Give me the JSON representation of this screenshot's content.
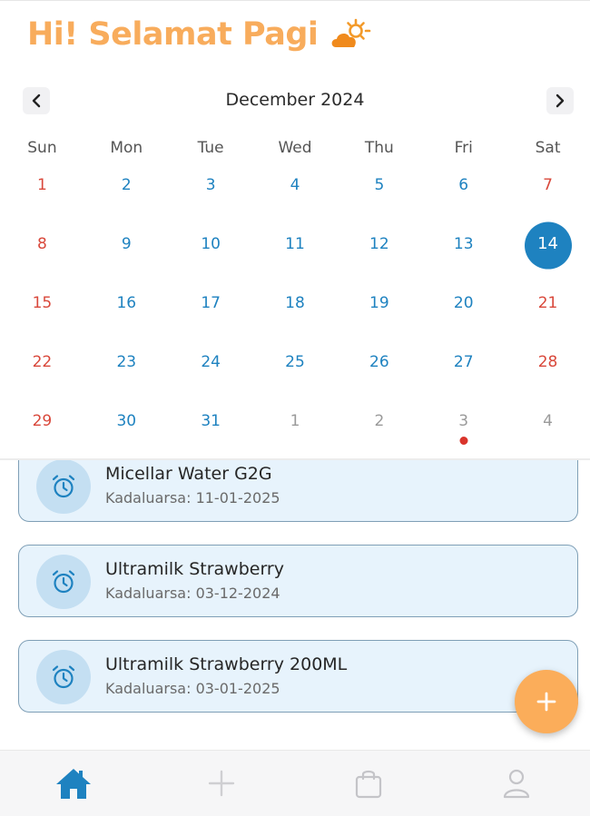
{
  "header": {
    "greeting": "Hi! Selamat Pagi",
    "weather_icon": "partly-sunny-icon"
  },
  "calendar": {
    "month_title": "December 2024",
    "prev_icon": "chevron-left-icon",
    "next_icon": "chevron-right-icon",
    "weekdays": [
      "Sun",
      "Mon",
      "Tue",
      "Wed",
      "Thu",
      "Fri",
      "Sat"
    ],
    "days": [
      {
        "label": "1",
        "type": "weekend"
      },
      {
        "label": "2",
        "type": "weekday"
      },
      {
        "label": "3",
        "type": "weekday"
      },
      {
        "label": "4",
        "type": "weekday"
      },
      {
        "label": "5",
        "type": "weekday"
      },
      {
        "label": "6",
        "type": "weekday"
      },
      {
        "label": "7",
        "type": "weekend"
      },
      {
        "label": "8",
        "type": "weekend"
      },
      {
        "label": "9",
        "type": "weekday"
      },
      {
        "label": "10",
        "type": "weekday"
      },
      {
        "label": "11",
        "type": "weekday"
      },
      {
        "label": "12",
        "type": "weekday"
      },
      {
        "label": "13",
        "type": "weekday"
      },
      {
        "label": "14",
        "type": "selected"
      },
      {
        "label": "15",
        "type": "weekend"
      },
      {
        "label": "16",
        "type": "weekday"
      },
      {
        "label": "17",
        "type": "weekday"
      },
      {
        "label": "18",
        "type": "weekday"
      },
      {
        "label": "19",
        "type": "weekday"
      },
      {
        "label": "20",
        "type": "weekday"
      },
      {
        "label": "21",
        "type": "weekend"
      },
      {
        "label": "22",
        "type": "weekend"
      },
      {
        "label": "23",
        "type": "weekday"
      },
      {
        "label": "24",
        "type": "weekday"
      },
      {
        "label": "25",
        "type": "weekday"
      },
      {
        "label": "26",
        "type": "weekday"
      },
      {
        "label": "27",
        "type": "weekday"
      },
      {
        "label": "28",
        "type": "weekend"
      },
      {
        "label": "29",
        "type": "weekend"
      },
      {
        "label": "30",
        "type": "weekday"
      },
      {
        "label": "31",
        "type": "weekday"
      },
      {
        "label": "1",
        "type": "other"
      },
      {
        "label": "2",
        "type": "other"
      },
      {
        "label": "3",
        "type": "other",
        "event_dot": true
      },
      {
        "label": "4",
        "type": "other"
      }
    ]
  },
  "items": [
    {
      "name": "Micellar Water G2G",
      "expiry": "Kadaluarsa: 11-01-2025",
      "icon": "alarm-clock-icon"
    },
    {
      "name": "Ultramilk Strawberry",
      "expiry": "Kadaluarsa: 03-12-2024",
      "icon": "alarm-clock-icon"
    },
    {
      "name": "Ultramilk Strawberry 200ML",
      "expiry": "Kadaluarsa: 03-01-2025",
      "icon": "alarm-clock-icon"
    }
  ],
  "fab": {
    "icon": "plus-icon"
  },
  "bottom_nav": [
    {
      "name": "home",
      "icon": "home-icon",
      "active": true
    },
    {
      "name": "add",
      "icon": "plus-icon",
      "active": false
    },
    {
      "name": "bag",
      "icon": "shopping-bag-icon",
      "active": false
    },
    {
      "name": "profile",
      "icon": "user-icon",
      "active": false
    }
  ],
  "colors": {
    "greeting": "#f8ac5c",
    "accent": "#1e82c0",
    "weekend": "#d9483b",
    "other_month": "#9a9a9a",
    "card_bg": "#e7f3fc",
    "fab": "#fbad5a"
  }
}
